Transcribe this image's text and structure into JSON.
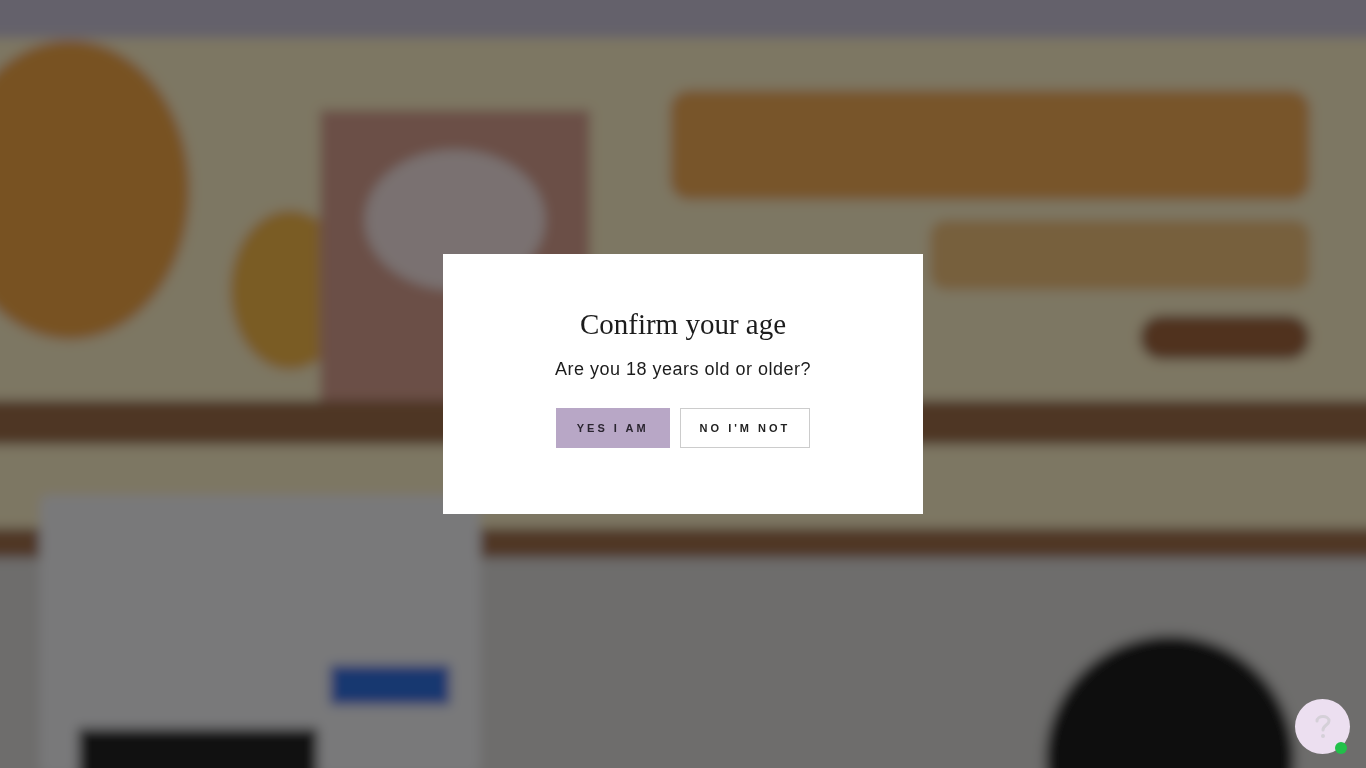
{
  "age_dialog": {
    "title": "Confirm your age",
    "question": "Are you 18 years old or older?",
    "buttons": [
      {
        "label": "YES I AM",
        "kind": "primary"
      },
      {
        "label": "NO I'M NOT",
        "kind": "secondary"
      }
    ]
  }
}
